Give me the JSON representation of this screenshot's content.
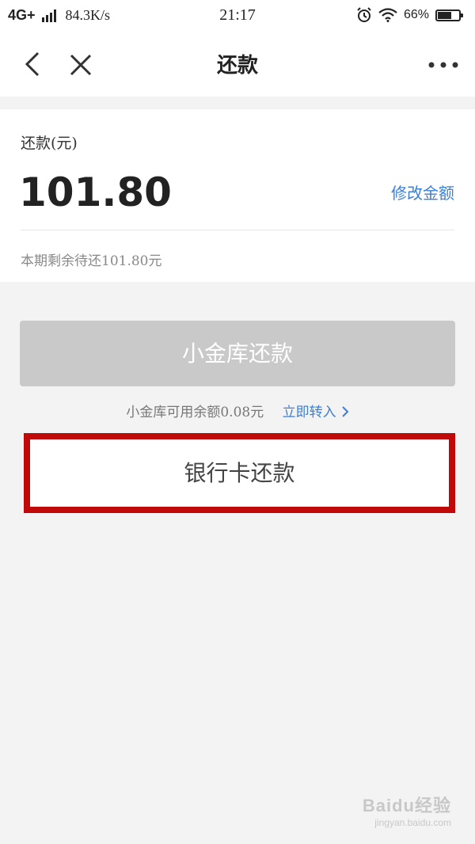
{
  "status_bar": {
    "network": "4G+",
    "speed": "84.3K/s",
    "time": "21:17",
    "battery": "66%",
    "battery_level": 0.66,
    "icons": [
      "signal-icon",
      "alarm-icon",
      "wifi-icon",
      "battery-icon"
    ]
  },
  "nav": {
    "title": "还款",
    "icons": [
      "back-icon",
      "close-icon",
      "more-icon"
    ]
  },
  "card": {
    "label": "还款(元)",
    "amount": "101.80",
    "modify": "修改金额",
    "remaining": "本期剩余待还101.80元"
  },
  "vault": {
    "button": "小金库还款",
    "balance_text": "小金库可用余额0.08元",
    "transfer": "立即转入"
  },
  "bank": {
    "button": "银行卡还款"
  },
  "watermark": {
    "main": "Baidu经验",
    "sub": "jingyan.baidu.com"
  },
  "colors": {
    "accent_link": "#3d7fd4",
    "highlight": "#c00a0a",
    "disabled_button": "#c9c9c9"
  }
}
